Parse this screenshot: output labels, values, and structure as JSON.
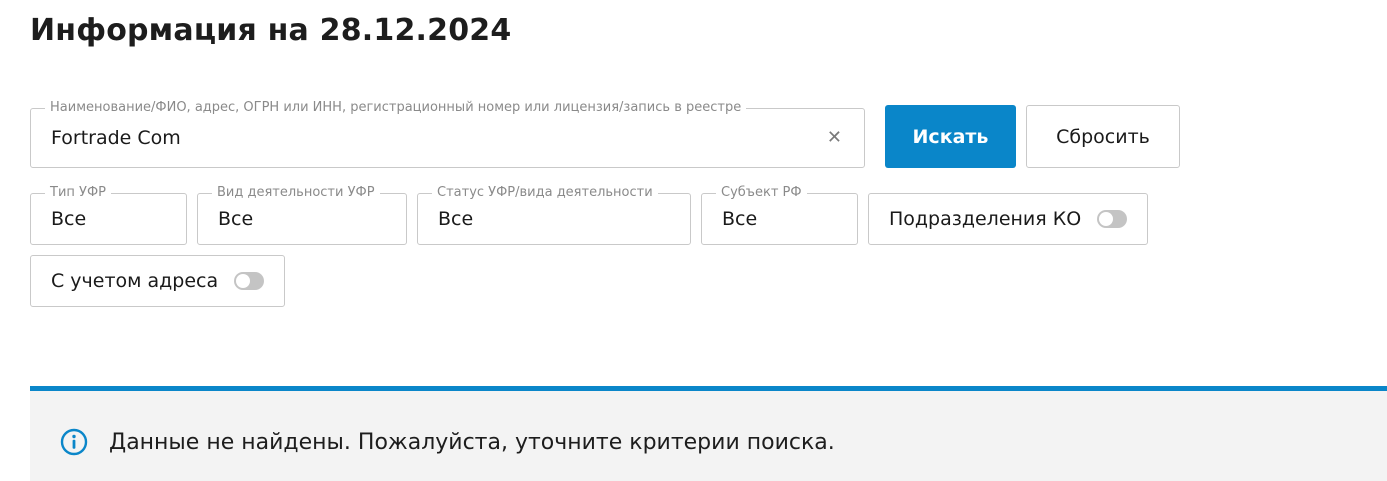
{
  "page": {
    "title": "Информация на 28.12.2024"
  },
  "search": {
    "label": "Наименование/ФИО, адрес, ОГРН или ИНН, регистрационный номер или лицензия/запись в реестре",
    "value": "Fortrade Com",
    "clear_icon": "close-icon"
  },
  "buttons": {
    "search_label": "Искать",
    "reset_label": "Сбросить"
  },
  "filters": {
    "ufr_type": {
      "label": "Тип УФР",
      "value": "Все"
    },
    "ufr_activity": {
      "label": "Вид деятельности УФР",
      "value": "Все"
    },
    "ufr_status": {
      "label": "Статус УФР/вида деятельности",
      "value": "Все"
    },
    "region": {
      "label": "Субъект РФ",
      "value": "Все"
    }
  },
  "toggles": {
    "ko_divisions": {
      "label": "Подразделения КО",
      "on": false
    },
    "with_address": {
      "label": "С учетом адреса",
      "on": false
    }
  },
  "alert": {
    "text": "Данные не найдены. Пожалуйста, уточните критерии поиска.",
    "icon": "info-icon"
  },
  "colors": {
    "accent": "#0a86c9",
    "alert_bg": "#f3f3f3",
    "toggle_off": "#c4c4c4",
    "border": "#c9c9c9"
  }
}
